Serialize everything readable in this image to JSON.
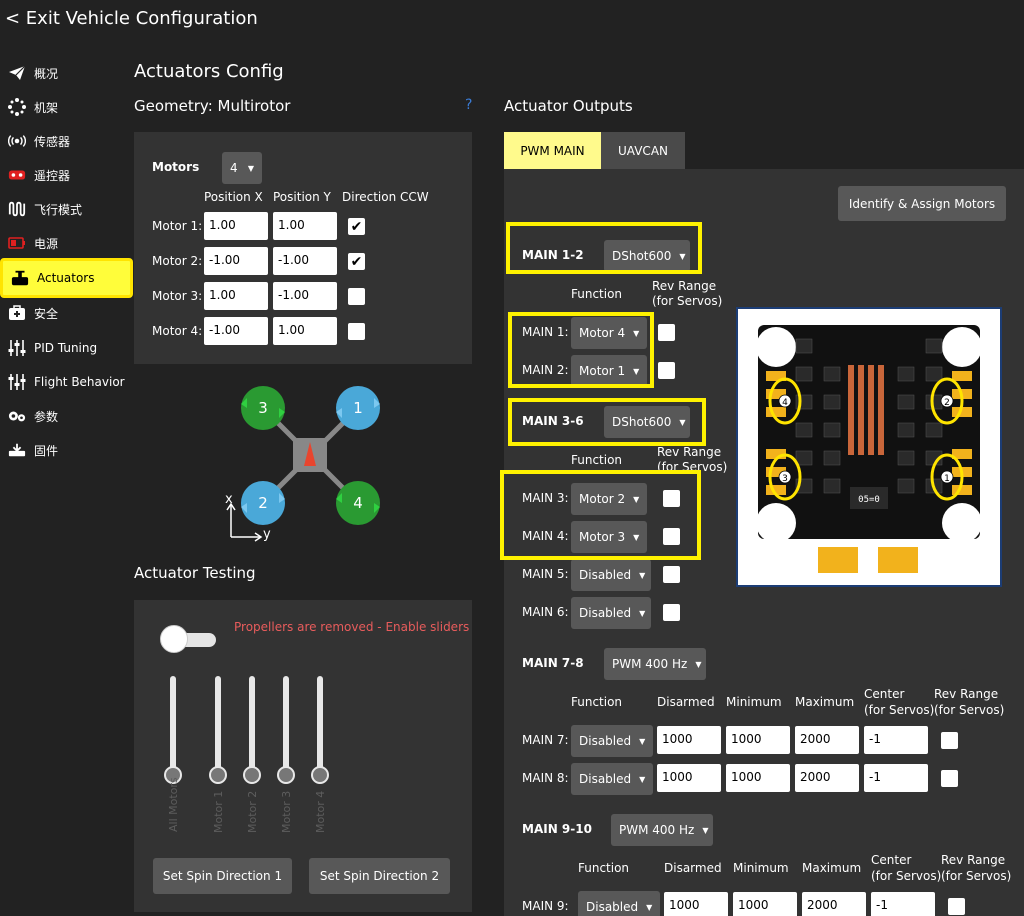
{
  "header": {
    "exit_label": "< Exit Vehicle Configuration"
  },
  "sidebar": {
    "items": [
      {
        "label": "概况",
        "icon": "paper-plane-icon"
      },
      {
        "label": "机架",
        "icon": "airframe-icon"
      },
      {
        "label": "传感器",
        "icon": "sensors-icon"
      },
      {
        "label": "遥控器",
        "icon": "remote-control-icon"
      },
      {
        "label": "飞行模式",
        "icon": "flight-modes-icon"
      },
      {
        "label": "电源",
        "icon": "battery-icon"
      },
      {
        "label": "Actuators",
        "icon": "actuator-icon",
        "active": true
      },
      {
        "label": "安全",
        "icon": "safety-icon"
      },
      {
        "label": "PID Tuning",
        "icon": "tuning-sliders-icon"
      },
      {
        "label": "Flight Behavior",
        "icon": "flight-behavior-icon"
      },
      {
        "label": "参数",
        "icon": "parameters-icon"
      },
      {
        "label": "固件",
        "icon": "firmware-icon"
      }
    ]
  },
  "page": {
    "title": "Actuators Config"
  },
  "geometry": {
    "title": "Geometry: Multirotor",
    "help": "?",
    "motors_label": "Motors",
    "motors_count": "4",
    "col_posx": "Position X",
    "col_posy": "Position Y",
    "col_ccw": "Direction CCW",
    "rows": [
      {
        "label": "Motor 1:",
        "x": "1.00",
        "y": "1.00",
        "ccw": true
      },
      {
        "label": "Motor 2:",
        "x": "-1.00",
        "y": "-1.00",
        "ccw": true
      },
      {
        "label": "Motor 3:",
        "x": "1.00",
        "y": "-1.00",
        "ccw": false
      },
      {
        "label": "Motor 4:",
        "x": "-1.00",
        "y": "1.00",
        "ccw": false
      }
    ],
    "diagram": {
      "motor_labels": [
        "1",
        "2",
        "3",
        "4"
      ],
      "axis_x": "x",
      "axis_y": "y",
      "cw_color": "#4aa8d8",
      "ccw_color": "#2a9a32"
    }
  },
  "testing": {
    "title": "Actuator Testing",
    "warning": "Propellers are removed - Enable sliders",
    "sliders": [
      "All Motors",
      "Motor 1",
      "Motor 2",
      "Motor 3",
      "Motor 4"
    ],
    "spin1": "Set Spin Direction 1",
    "spin2": "Set Spin Direction 2"
  },
  "outputs": {
    "title": "Actuator Outputs",
    "tabs": [
      {
        "label": "PWM MAIN",
        "active": true
      },
      {
        "label": "UAVCAN",
        "active": false
      }
    ],
    "identify_button": "Identify & Assign Motors",
    "group1": {
      "label": "MAIN 1-2",
      "protocol": "DShot600"
    },
    "group2": {
      "label": "MAIN 3-6",
      "protocol": "DShot600"
    },
    "group3": {
      "label": "MAIN 7-8",
      "protocol": "PWM 400 Hz"
    },
    "group4": {
      "label": "MAIN 9-10",
      "protocol": "PWM 400 Hz"
    },
    "col_function": "Function",
    "col_rev": "Rev Range\n(for Servos)",
    "col_disarmed": "Disarmed",
    "col_min": "Minimum",
    "col_max": "Maximum",
    "col_center": "Center\n(for Servos)",
    "main1": {
      "label": "MAIN 1:",
      "function": "Motor 4"
    },
    "main2": {
      "label": "MAIN 2:",
      "function": "Motor 1"
    },
    "main3": {
      "label": "MAIN 3:",
      "function": "Motor 2"
    },
    "main4": {
      "label": "MAIN 4:",
      "function": "Motor 3"
    },
    "main5": {
      "label": "MAIN 5:",
      "function": "Disabled"
    },
    "main6": {
      "label": "MAIN 6:",
      "function": "Disabled"
    },
    "main7": {
      "label": "MAIN 7:",
      "function": "Disabled",
      "disarmed": "1000",
      "min": "1000",
      "max": "2000",
      "center": "-1"
    },
    "main8": {
      "label": "MAIN 8:",
      "function": "Disabled",
      "disarmed": "1000",
      "min": "1000",
      "max": "2000",
      "center": "-1"
    },
    "main9": {
      "label": "MAIN 9:",
      "function": "Disabled",
      "disarmed": "1000",
      "min": "1000",
      "max": "2000",
      "center": "-1"
    },
    "board": {
      "pad_labels": [
        "4",
        "2",
        "3",
        "1"
      ],
      "chip_label": "05=0"
    }
  },
  "colors": {
    "background": "#222222",
    "panel": "#333333",
    "highlight": "#fff200",
    "warning": "#e85c5c",
    "tab_active": "#fffa8c"
  }
}
